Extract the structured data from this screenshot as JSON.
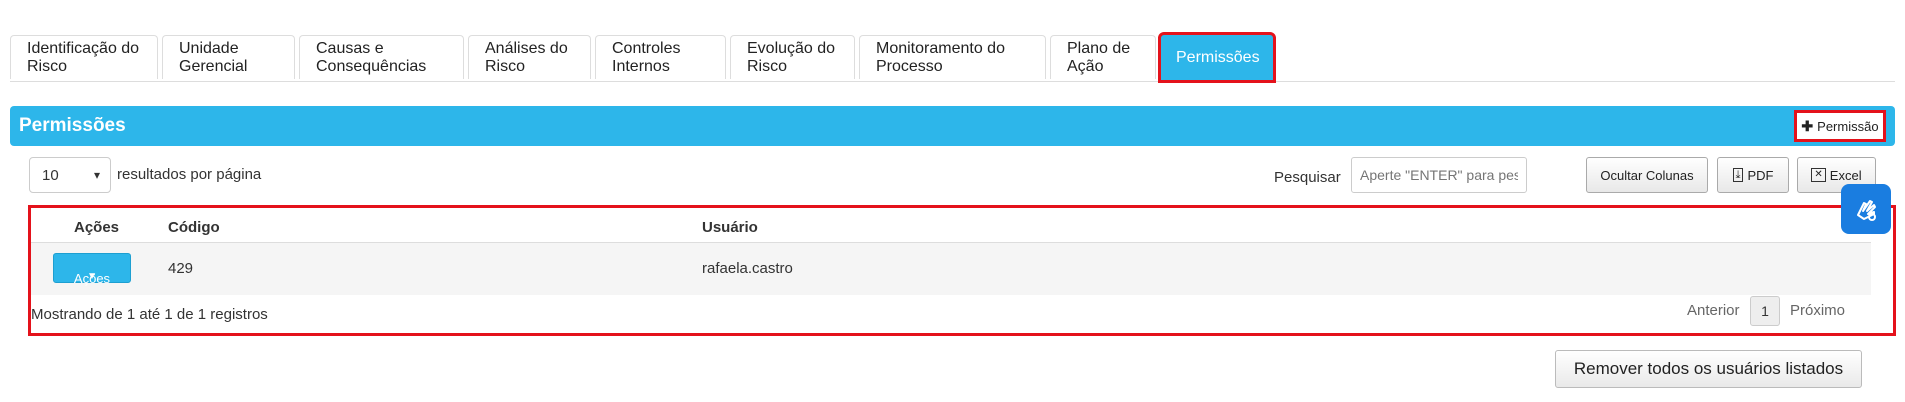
{
  "tabs": [
    {
      "label": "Identificação do Risco"
    },
    {
      "label": "Unidade Gerencial"
    },
    {
      "label": "Causas e Consequências"
    },
    {
      "label": "Análises do Risco"
    },
    {
      "label": "Controles Internos"
    },
    {
      "label": "Evolução do Risco"
    },
    {
      "label": "Monitoramento do Processo"
    },
    {
      "label": "Plano de Ação"
    },
    {
      "label": "Permissões",
      "active": true
    }
  ],
  "panel": {
    "title": "Permissões",
    "add_label": "Permissão",
    "add_icon": "plus-icon"
  },
  "controls": {
    "page_size": "10",
    "per_page_label": "resultados por página",
    "search_label": "Pesquisar",
    "search_placeholder": "Aperte \"ENTER\" para pesquisar",
    "hide_columns": "Ocultar Colunas",
    "pdf": "PDF",
    "excel": "Excel"
  },
  "table": {
    "headers": {
      "actions": "Ações",
      "code": "Código",
      "user": "Usuário"
    },
    "rows": [
      {
        "action_label": "Ações",
        "code": "429",
        "user": "rafaela.castro"
      }
    ],
    "info": "Mostrando de 1 até 1 de 1 registros",
    "prev": "Anterior",
    "page": "1",
    "next": "Próximo"
  },
  "remove_all": "Remover todos os usuários listados",
  "colors": {
    "accent": "#2db6ea",
    "highlight": "#e4121b",
    "a11y": "#1a7de0"
  }
}
